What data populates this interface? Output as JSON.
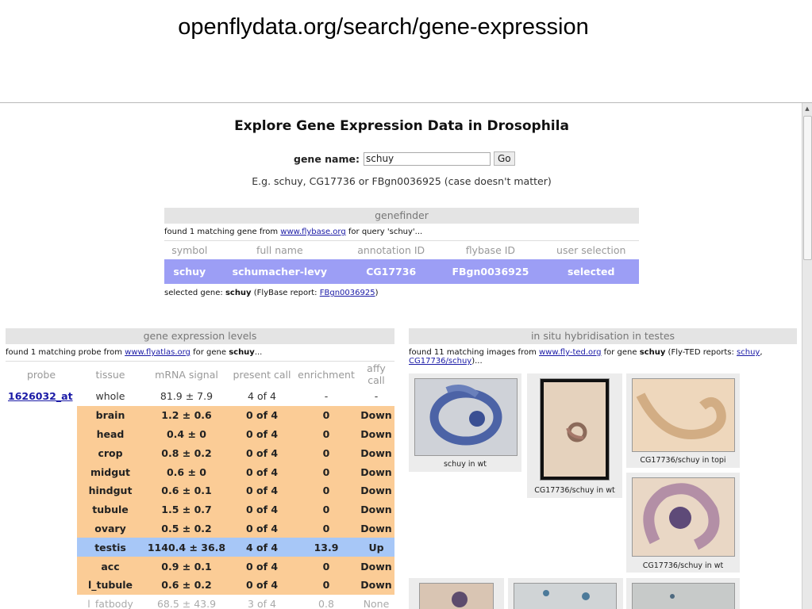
{
  "slide_title": "openflydata.org/search/gene-expression",
  "page": {
    "heading": "Explore Gene Expression Data in Drosophila",
    "search": {
      "label": "gene name:",
      "value": "schuy",
      "go_label": "Go"
    },
    "example": "E.g. schuy, CG17736 or FBgn0036925 (case doesn't matter)"
  },
  "genefinder": {
    "title": "genefinder",
    "info_pre": "found 1 matching gene from ",
    "info_link": "www.flybase.org",
    "info_post": " for query 'schuy'...",
    "columns": [
      "symbol",
      "full name",
      "annotation ID",
      "flybase ID",
      "user selection"
    ],
    "row": {
      "symbol": "schuy",
      "full_name": "schumacher-levy",
      "annotation_id": "CG17736",
      "flybase_id": "FBgn0036925",
      "user_selection": "selected"
    },
    "selected_pre": "selected gene: ",
    "selected_gene": "schuy",
    "selected_mid": " (FlyBase report: ",
    "selected_link": "FBgn0036925",
    "selected_post": ")"
  },
  "expression": {
    "title": "gene expression levels",
    "info_pre": "found 1 matching probe from ",
    "info_link": "www.flyatlas.org",
    "info_mid": " for gene ",
    "info_gene": "schuy",
    "info_post": "...",
    "columns": [
      "probe",
      "tissue",
      "mRNA signal",
      "present call",
      "enrichment",
      "affy call"
    ],
    "probe": "1626032_at",
    "rows": [
      {
        "tissue": "whole",
        "signal": "81.9 ± 7.9",
        "present": "4 of 4",
        "enrichment": "-",
        "affy": "-",
        "style": "normal"
      },
      {
        "tissue": "brain",
        "signal": "1.2 ± 0.6",
        "present": "0 of 4",
        "enrichment": "0",
        "affy": "Down",
        "style": "down"
      },
      {
        "tissue": "head",
        "signal": "0.4 ± 0",
        "present": "0 of 4",
        "enrichment": "0",
        "affy": "Down",
        "style": "down"
      },
      {
        "tissue": "crop",
        "signal": "0.8 ± 0.2",
        "present": "0 of 4",
        "enrichment": "0",
        "affy": "Down",
        "style": "down"
      },
      {
        "tissue": "midgut",
        "signal": "0.6 ± 0",
        "present": "0 of 4",
        "enrichment": "0",
        "affy": "Down",
        "style": "down"
      },
      {
        "tissue": "hindgut",
        "signal": "0.6 ± 0.1",
        "present": "0 of 4",
        "enrichment": "0",
        "affy": "Down",
        "style": "down"
      },
      {
        "tissue": "tubule",
        "signal": "1.5 ± 0.7",
        "present": "0 of 4",
        "enrichment": "0",
        "affy": "Down",
        "style": "down"
      },
      {
        "tissue": "ovary",
        "signal": "0.5 ± 0.2",
        "present": "0 of 4",
        "enrichment": "0",
        "affy": "Down",
        "style": "down"
      },
      {
        "tissue": "testis",
        "signal": "1140.4 ± 36.8",
        "present": "4 of 4",
        "enrichment": "13.9",
        "affy": "Up",
        "style": "up"
      },
      {
        "tissue": "acc",
        "signal": "0.9 ± 0.1",
        "present": "0 of 4",
        "enrichment": "0",
        "affy": "Down",
        "style": "down"
      },
      {
        "tissue": "l_tubule",
        "signal": "0.6 ± 0.2",
        "present": "0 of 4",
        "enrichment": "0",
        "affy": "Down",
        "style": "down"
      },
      {
        "tissue": "l_fatbody",
        "signal": "68.5 ± 43.9",
        "present": "3 of 4",
        "enrichment": "0.8",
        "affy": "None",
        "style": "none"
      }
    ]
  },
  "insitu": {
    "title": "in situ hybridisation in testes",
    "info_pre": "found 11 matching images from ",
    "info_link": "www.fly-ted.org",
    "info_mid": " for gene ",
    "info_gene": "schuy",
    "info_mid2": " (Fly-TED reports: ",
    "report_link1": "schuy",
    "info_sep": ",",
    "report_link2": "CG17736/schuy",
    "info_post": ")...",
    "captions": [
      "schuy in wt",
      "CG17736/schuy in wt",
      "CG17736/schuy in topi",
      "CG17736/schuy in wt"
    ]
  },
  "colors": {
    "selected_row": "#9c9ef5",
    "down_row": "#fbcc96",
    "up_row": "#a7c7f7",
    "link": "#1a1aa6"
  }
}
